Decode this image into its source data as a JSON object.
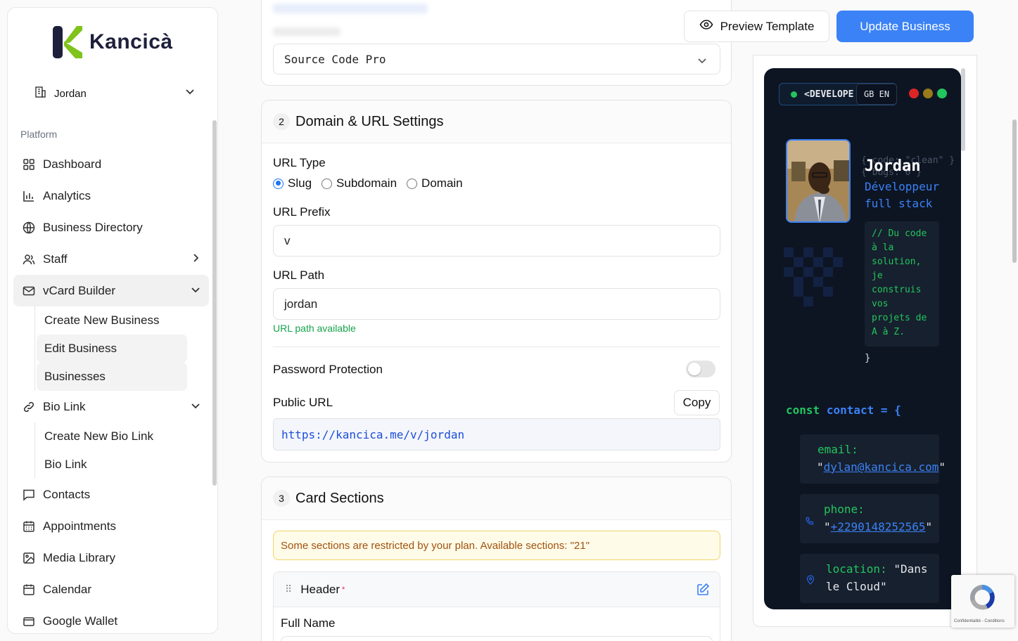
{
  "brand": {
    "name": "Kancicà"
  },
  "business_selector": {
    "value": "Jordan"
  },
  "sidebar": {
    "section_label": "Platform",
    "items": [
      {
        "label": "Dashboard",
        "icon": "grid-icon"
      },
      {
        "label": "Analytics",
        "icon": "bar-chart-icon"
      },
      {
        "label": "Business Directory",
        "icon": "globe-icon"
      },
      {
        "label": "Staff",
        "icon": "users-icon"
      },
      {
        "label": "vCard Builder",
        "icon": "mail-icon"
      },
      {
        "label": "Bio Link",
        "icon": "link-icon"
      },
      {
        "label": "Contacts",
        "icon": "message-icon"
      },
      {
        "label": "Appointments",
        "icon": "calendar-grid-icon"
      },
      {
        "label": "Media Library",
        "icon": "image-icon"
      },
      {
        "label": "Calendar",
        "icon": "calendar-icon"
      },
      {
        "label": "Google Wallet",
        "icon": "wallet-icon"
      }
    ],
    "vcard_sub": [
      "Create New Business",
      "Edit Business",
      "Businesses"
    ],
    "biolink_sub": [
      "Create New Bio Link",
      "Bio Link"
    ]
  },
  "font_select": {
    "value": "Source Code Pro"
  },
  "domain_section": {
    "step": "2",
    "title": "Domain & URL Settings",
    "url_type_label": "URL Type",
    "url_type_options": [
      "Slug",
      "Subdomain",
      "Domain"
    ],
    "url_type_selected": "Slug",
    "url_prefix_label": "URL Prefix",
    "url_prefix_value": "v",
    "url_path_label": "URL Path",
    "url_path_value": "jordan",
    "url_path_status": "URL path available",
    "password_label": "Password Protection",
    "password_enabled": false,
    "public_url_label": "Public URL",
    "copy_label": "Copy",
    "public_url": "https://kancica.me/v/jordan"
  },
  "card_sections": {
    "step": "3",
    "title": "Card Sections",
    "warning": "Some sections are restricted by your plan. Available sections: \"21\"",
    "header_item": "Header",
    "required_mark": "*",
    "full_name_label": "Full Name"
  },
  "toolbar": {
    "preview_label": "Preview Template",
    "update_label": "Update Business"
  },
  "preview": {
    "badge": "<DEVELOPE",
    "lang": "GB EN",
    "ghost_code": "{ code: \"clean\" }\n{ bugs: 0 }",
    "name": "Jordan",
    "role": "Développeur full stack",
    "comment": "// Du code à la solution, je construis vos projets de A à Z.",
    "brace": "}",
    "const_kw": "const",
    "const_name": "contact",
    "const_rest": "= {",
    "email_key": "email:",
    "email_value": "dylan@kancica.com",
    "phone_key": "phone:",
    "phone_value": "+2290148252565",
    "location_key": "location:",
    "location_value": "\"Dans le Cloud\"",
    "quote": "\""
  },
  "recaptcha": {
    "text": "Confidentialité - Conditions"
  },
  "colors": {
    "accent": "#3b82f6",
    "phone_bg": "#0d1523",
    "code_green": "#22c55e"
  }
}
